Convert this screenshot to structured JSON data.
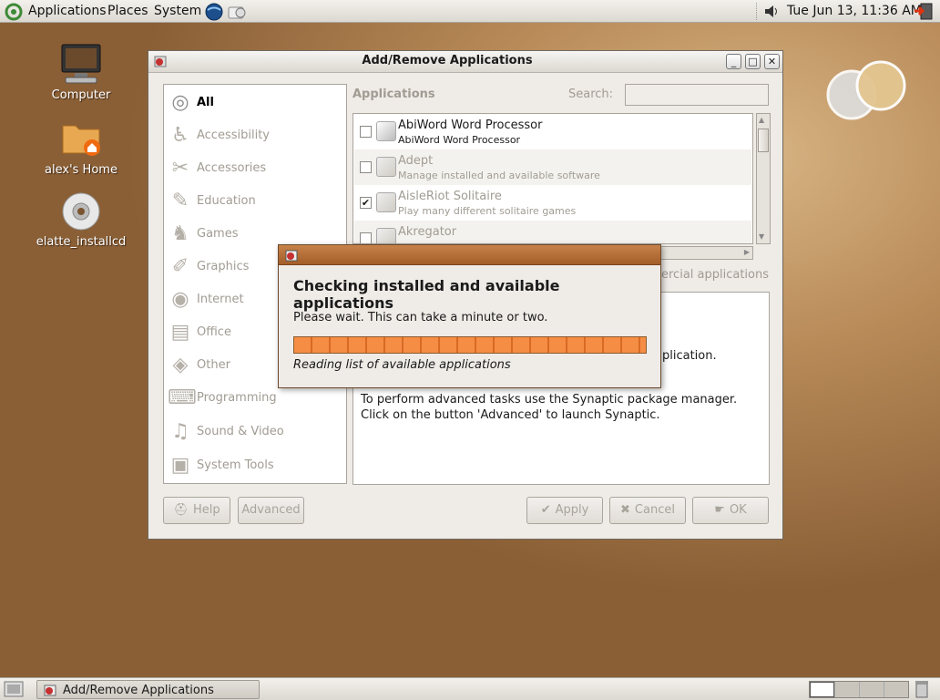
{
  "top_panel": {
    "applications": "Applications",
    "places": "Places",
    "system": "System",
    "clock": "Tue Jun 13, 11:36 AM"
  },
  "desktop": {
    "icons": [
      {
        "label": "Computer",
        "icon": "computer-icon"
      },
      {
        "label": "alex's Home",
        "icon": "home-folder-icon"
      },
      {
        "label": "elatte_installcd",
        "icon": "cd-icon"
      }
    ]
  },
  "bottom_panel": {
    "task_label": "Add/Remove Applications"
  },
  "main_window": {
    "title": "Add/Remove Applications",
    "categories": [
      {
        "label": "All",
        "icon": "all-icon",
        "active": true
      },
      {
        "label": "Accessibility",
        "icon": "accessibility-icon"
      },
      {
        "label": "Accessories",
        "icon": "accessories-icon"
      },
      {
        "label": "Education",
        "icon": "education-icon"
      },
      {
        "label": "Games",
        "icon": "games-icon"
      },
      {
        "label": "Graphics",
        "icon": "graphics-icon"
      },
      {
        "label": "Internet",
        "icon": "internet-icon"
      },
      {
        "label": "Office",
        "icon": "office-icon"
      },
      {
        "label": "Other",
        "icon": "other-icon"
      },
      {
        "label": "Programming",
        "icon": "programming-icon"
      },
      {
        "label": "Sound & Video",
        "icon": "sound-video-icon"
      },
      {
        "label": "System Tools",
        "icon": "system-tools-icon"
      }
    ],
    "applications_label": "Applications",
    "search_label": "Search:",
    "search_value": "",
    "apps": [
      {
        "name": "AbiWord Word Processor",
        "desc": "AbiWord Word Processor",
        "checked": false,
        "active": true
      },
      {
        "name": "Adept",
        "desc": "Manage installed and available software",
        "checked": false,
        "active": false
      },
      {
        "name": "AisleRiot Solitaire",
        "desc": "Play many different solitaire games",
        "checked": true,
        "active": false
      },
      {
        "name": "Akregator",
        "desc": "",
        "checked": false,
        "active": false
      }
    ],
    "commercial_partial": "ercial applications",
    "description_partial": "plication.",
    "advanced_text_1": "To perform advanced tasks use the Synaptic package manager.",
    "advanced_text_2": "Click on the button 'Advanced' to launch Synaptic.",
    "buttons": {
      "help": "Help",
      "advanced": "Advanced",
      "apply": "Apply",
      "cancel": "Cancel",
      "ok": "OK"
    }
  },
  "progress_dialog": {
    "heading": "Checking installed and available applications",
    "message": "Please wait. This can take a minute or two.",
    "status": "Reading list of available applications",
    "progress_percent": 100
  },
  "colors": {
    "progress_orange": "#f08a3c",
    "progress_title_bar": "#b26a30",
    "desktop_brown": "#9a6c3f"
  }
}
